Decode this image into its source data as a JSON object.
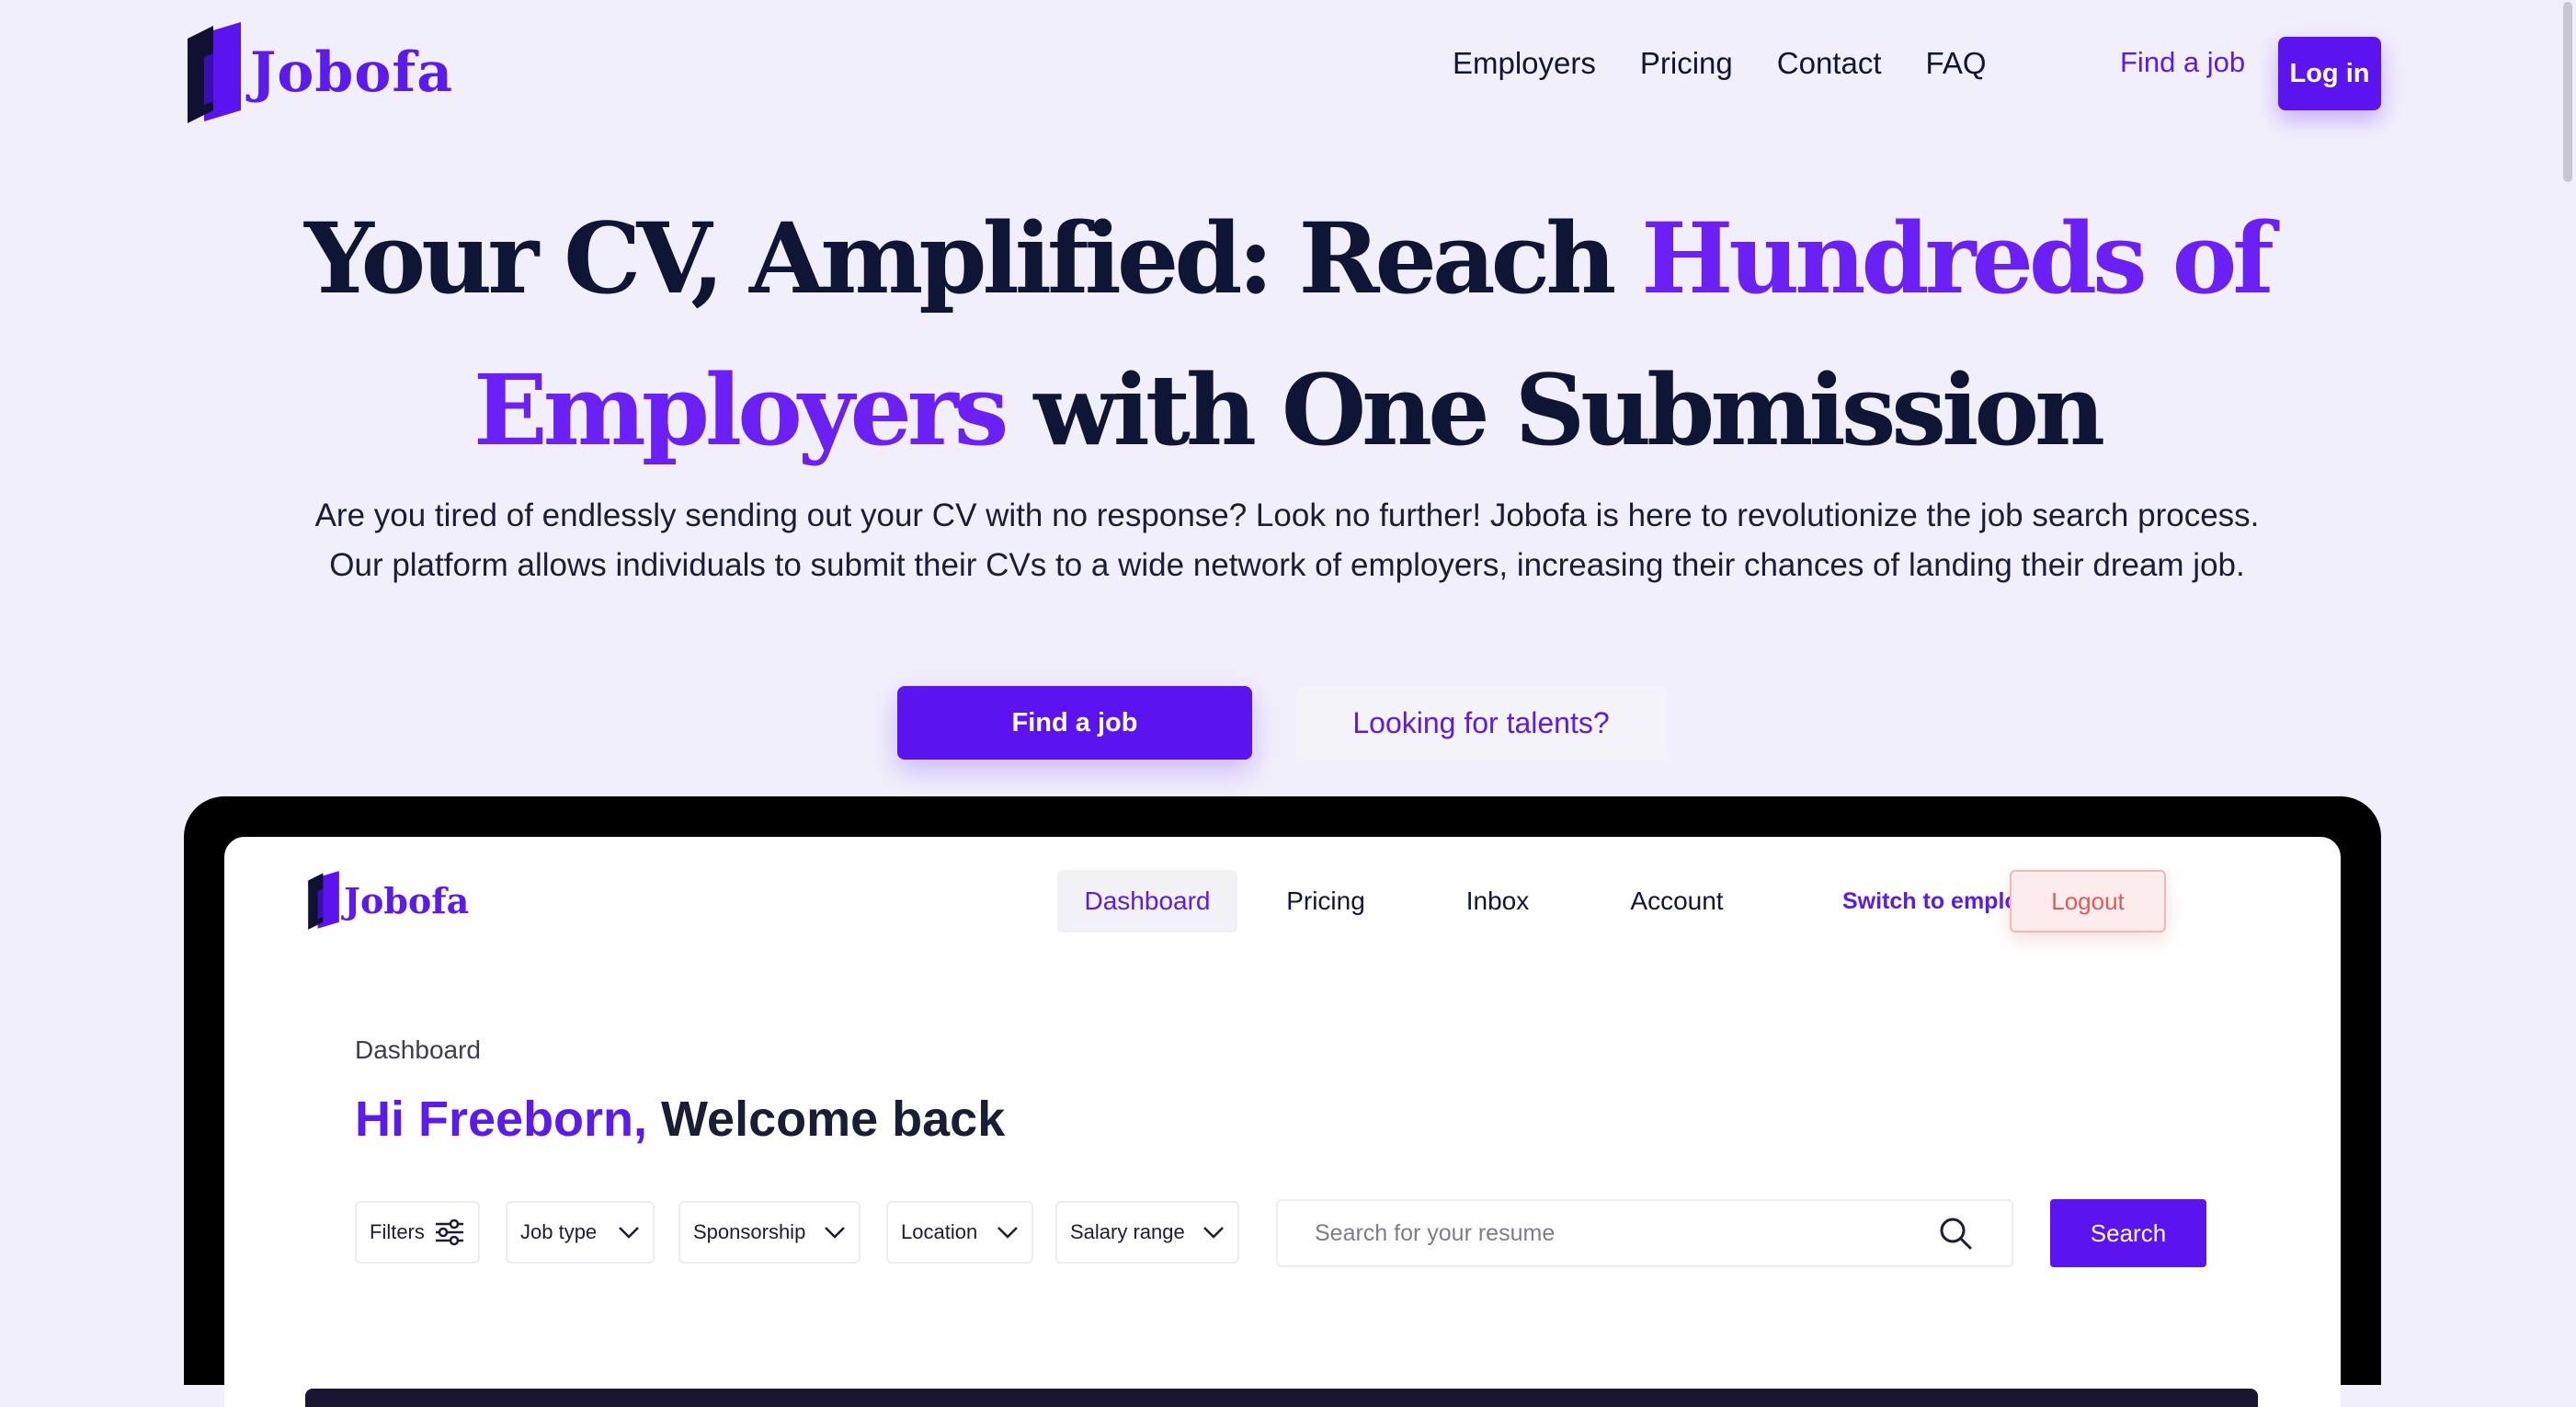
{
  "brand": {
    "name": "Jobofa",
    "primary_color": "#5B13EF",
    "dark_color": "#0F1535",
    "background_color": "#F2EFFC"
  },
  "nav": {
    "links": [
      "Employers",
      "Pricing",
      "Contact",
      "FAQ"
    ],
    "find_job": "Find a job",
    "login": "Log in"
  },
  "hero": {
    "title_part1": "Your CV, Amplified: Reach ",
    "title_accent": "Hundreds of Employers",
    "title_part2": " with One Submission",
    "subtitle": "Are you tired of endlessly sending out your CV with no response? Look no further! Jobofa is here to revolutionize the job search process. Our platform allows individuals to submit their CVs to a wide network of employers, increasing their chances of landing their dream job.",
    "cta_primary": "Find a job",
    "cta_secondary": "Looking for talents?"
  },
  "dashboard": {
    "logo": "Jobofa",
    "nav": {
      "dashboard": "Dashboard",
      "pricing": "Pricing",
      "inbox": "Inbox",
      "account": "Account",
      "switch": "Switch to employer",
      "logout": "Logout"
    },
    "breadcrumb": "Dashboard",
    "greeting_accent": "Hi Freeborn,",
    "greeting_rest": " Welcome back",
    "filters": {
      "filters": "Filters",
      "job_type": "Job type",
      "sponsorship": "Sponsorship",
      "location": "Location",
      "salary_range": "Salary range"
    },
    "search_placeholder": "Search for your resume",
    "search_button": "Search"
  }
}
